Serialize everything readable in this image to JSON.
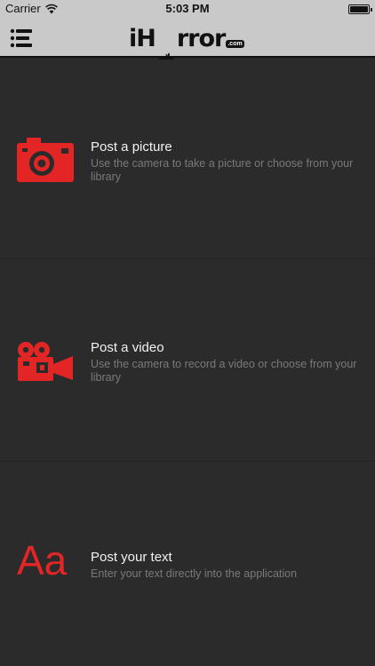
{
  "status_bar": {
    "carrier": "Carrier",
    "time": "5:03 PM",
    "battery_level": 1.0
  },
  "nav_bar": {
    "menu_icon": "hamburger-menu-icon",
    "logo": {
      "text_before": "iH",
      "text_after": "rror",
      "dotcom": ".com"
    }
  },
  "colors": {
    "accent": "#e32526",
    "background": "#2b2b2b",
    "bar": "#c9c9c9",
    "title": "#f2f2f2",
    "description": "#7a7a7a"
  },
  "options": [
    {
      "icon": "camera-icon",
      "title": "Post a picture",
      "description": "Use the camera to take a picture or choose from your library"
    },
    {
      "icon": "video-camera-icon",
      "title": "Post a video",
      "description": "Use the camera to record a video or choose from your library"
    },
    {
      "icon": "text-icon",
      "icon_text": "Aa",
      "title": "Post your text",
      "description": "Enter your text directly into the application"
    }
  ]
}
